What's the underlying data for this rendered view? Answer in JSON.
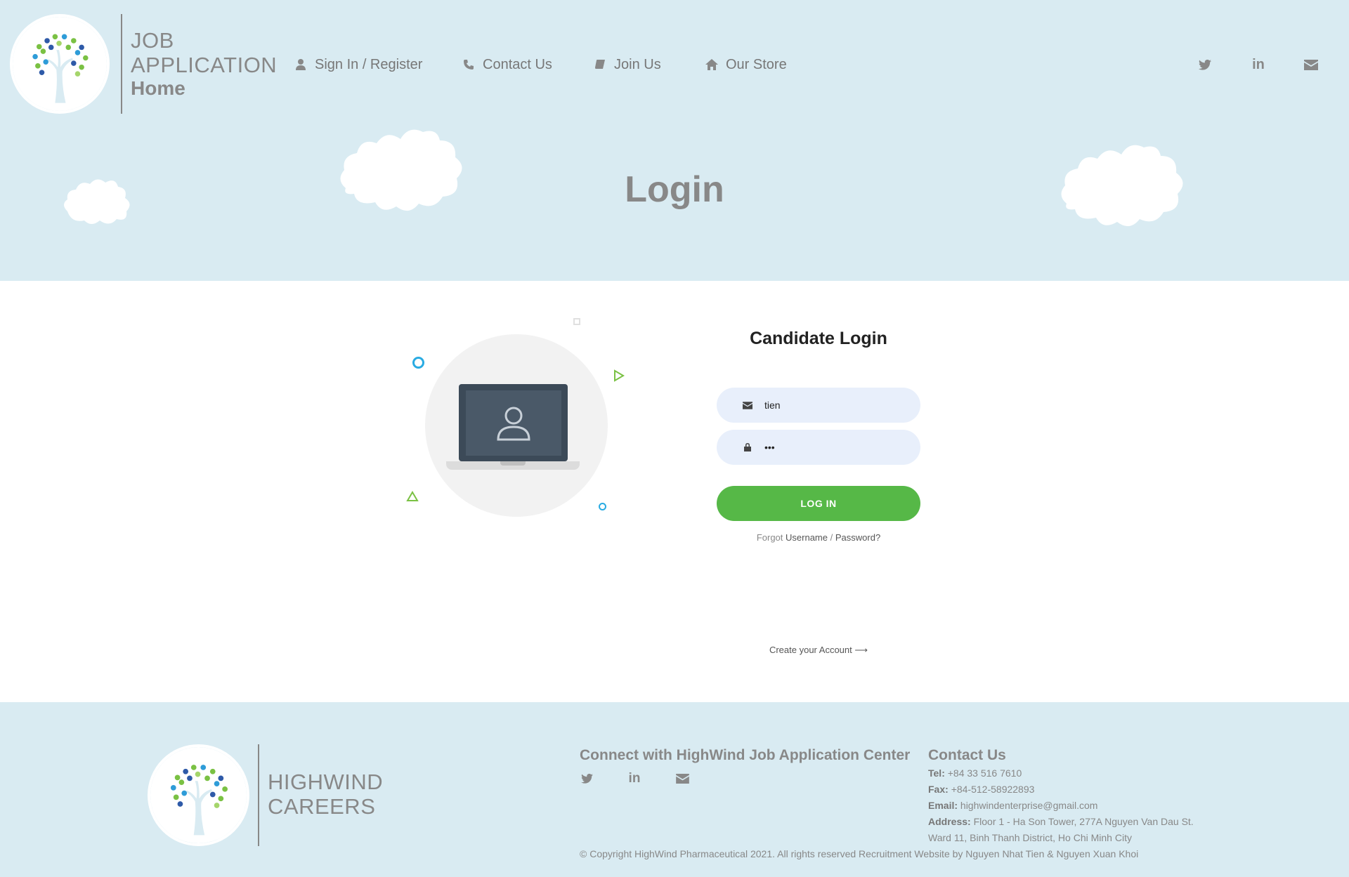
{
  "header": {
    "brand_line1": "JOB",
    "brand_line2": "APPLICATION",
    "brand_sub": "Home",
    "nav": [
      {
        "label": "Sign In / Register",
        "icon": "user-icon"
      },
      {
        "label": "Contact Us",
        "icon": "phone-icon"
      },
      {
        "label": "Join Us",
        "icon": "book-icon"
      },
      {
        "label": "Our Store",
        "icon": "home-icon"
      }
    ],
    "social": [
      {
        "icon": "twitter-icon"
      },
      {
        "icon": "linkedin-icon",
        "text": "in"
      },
      {
        "icon": "envelope-icon"
      }
    ]
  },
  "page_title": "Login",
  "login": {
    "title": "Candidate Login",
    "username_value": "tien",
    "password_value": "•••",
    "button_label": "LOG IN",
    "forgot_prefix": "Forgot",
    "forgot_username": "Username",
    "forgot_sep": "/",
    "forgot_password": "Password?",
    "create_account": "Create your Account ⟶"
  },
  "footer": {
    "brand_line1": "HIGHWIND",
    "brand_line2": "CAREERS",
    "connect_title": "Connect with HighWind Job Application Center",
    "social_linkedin_text": "in",
    "contact_title": "Contact Us",
    "tel_label": "Tel:",
    "tel_value": "+84 33 516 7610",
    "fax_label": "Fax:",
    "fax_value": "+84-512-58922893",
    "email_label": "Email:",
    "email_value": "highwindenterprise@gmail.com",
    "address_label": "Address:",
    "address_line1": "Floor 1 - Ha Son Tower, 277A Nguyen Van Dau St.",
    "address_line2": "Ward 11, Binh Thanh District, Ho Chi Minh City",
    "copyright": "© Copyright HighWind Pharmaceutical 2021. All rights reserved Recruitment Website by Nguyen Nhat Tien & Nguyen Xuan Khoi"
  },
  "colors": {
    "header_bg": "#d9ebf2",
    "accent_green": "#56b847",
    "input_bg": "#e8effb",
    "text_gray": "#888888"
  }
}
